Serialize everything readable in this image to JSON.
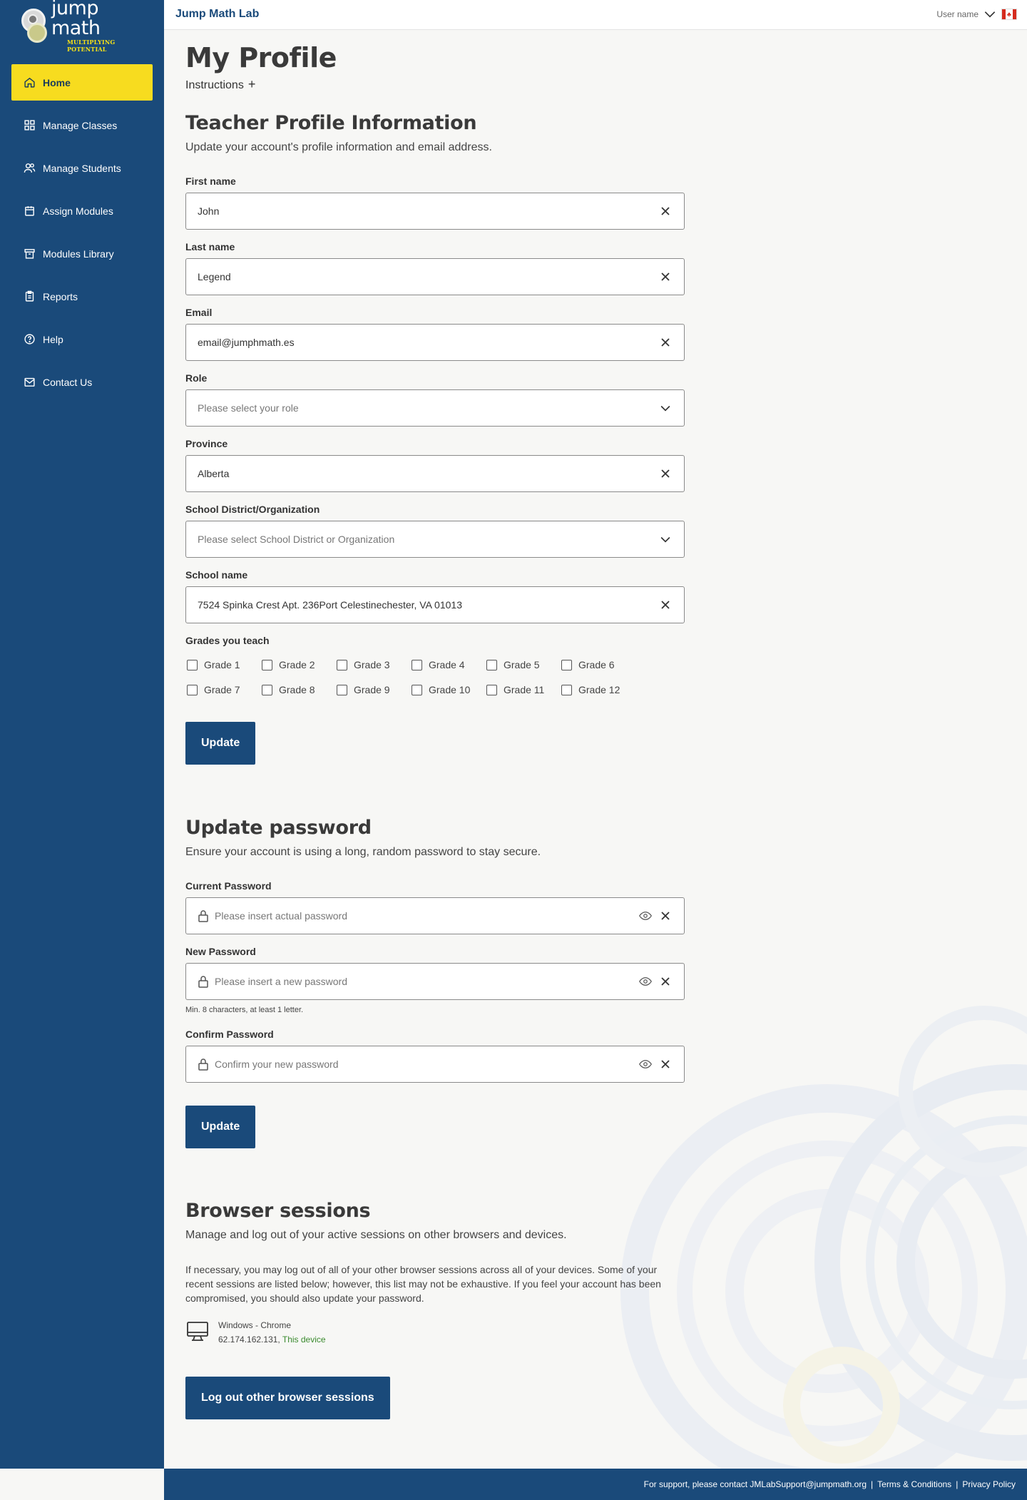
{
  "brand": {
    "logo_word": "jump math",
    "logo_tagline": "MULTIPLYING POTENTIAL",
    "app_title": "Jump Math Lab"
  },
  "user": {
    "name": "User name",
    "flag": "canada-flag"
  },
  "nav": {
    "items": [
      {
        "label": "Home",
        "icon": "home-icon",
        "active": true
      },
      {
        "label": "Manage Classes",
        "icon": "grid-icon"
      },
      {
        "label": "Manage Students",
        "icon": "students-icon"
      },
      {
        "label": "Assign Modules",
        "icon": "assign-icon"
      },
      {
        "label": "Modules Library",
        "icon": "library-icon"
      },
      {
        "label": "Reports",
        "icon": "reports-icon"
      },
      {
        "label": "Help",
        "icon": "help-icon"
      },
      {
        "label": "Contact Us",
        "icon": "mail-icon"
      }
    ]
  },
  "page": {
    "title": "My Profile",
    "instructions_label": "Instructions"
  },
  "profile": {
    "title": "Teacher Profile Information",
    "description": "Update your account's profile information and email address.",
    "first_name": {
      "label": "First name",
      "value": "John"
    },
    "last_name": {
      "label": "Last name",
      "value": "Legend"
    },
    "email": {
      "label": "Email",
      "value": "email@jumphmath.es"
    },
    "role": {
      "label": "Role",
      "placeholder": "Please select your role"
    },
    "province": {
      "label": "Province",
      "value": "Alberta"
    },
    "district": {
      "label": "School District/Organization",
      "placeholder": "Please select School District or Organization"
    },
    "school": {
      "label": "School name",
      "value": "7524 Spinka Crest Apt. 236Port Celestinechester, VA 01013"
    },
    "grades_label": "Grades you teach",
    "grades": [
      "Grade 1",
      "Grade 2",
      "Grade 3",
      "Grade 4",
      "Grade 5",
      "Grade 6",
      "Grade 7",
      "Grade 8",
      "Grade 9",
      "Grade 10",
      "Grade 11",
      "Grade 12"
    ],
    "update_label": "Update"
  },
  "password": {
    "title": "Update password",
    "description": "Ensure your account is using a long, random password to stay secure.",
    "current": {
      "label": "Current Password",
      "placeholder": "Please insert actual password"
    },
    "new": {
      "label": "New Password",
      "placeholder": "Please insert a new password",
      "hint": "Min. 8 characters, at least 1 letter."
    },
    "confirm": {
      "label": "Confirm Password",
      "placeholder": "Confirm your new password"
    },
    "update_label": "Update"
  },
  "sessions": {
    "title": "Browser sessions",
    "description": "Manage and log out of your active sessions on other browsers and devices.",
    "paragraph": "If necessary, you may log out of all of your other browser sessions across all of your devices. Some of your recent sessions are listed below; however, this list may not be exhaustive. If you feel your account has been compromised, you should also update your password.",
    "device": {
      "platform": "Windows - Chrome",
      "ip": "62.174.162.131,",
      "current_label": "This device"
    },
    "logout_label": "Log out other browser sessions"
  },
  "footer": {
    "support_text": "For support, please contact JMLabSupport@jumpmath.org",
    "terms": "Terms & Conditions",
    "privacy": "Privacy Policy",
    "separator": "|"
  },
  "colors": {
    "primary": "#1a4a7a",
    "accent": "#f7dc1f",
    "background": "#f7f7f5",
    "success": "#3a8a2e"
  }
}
